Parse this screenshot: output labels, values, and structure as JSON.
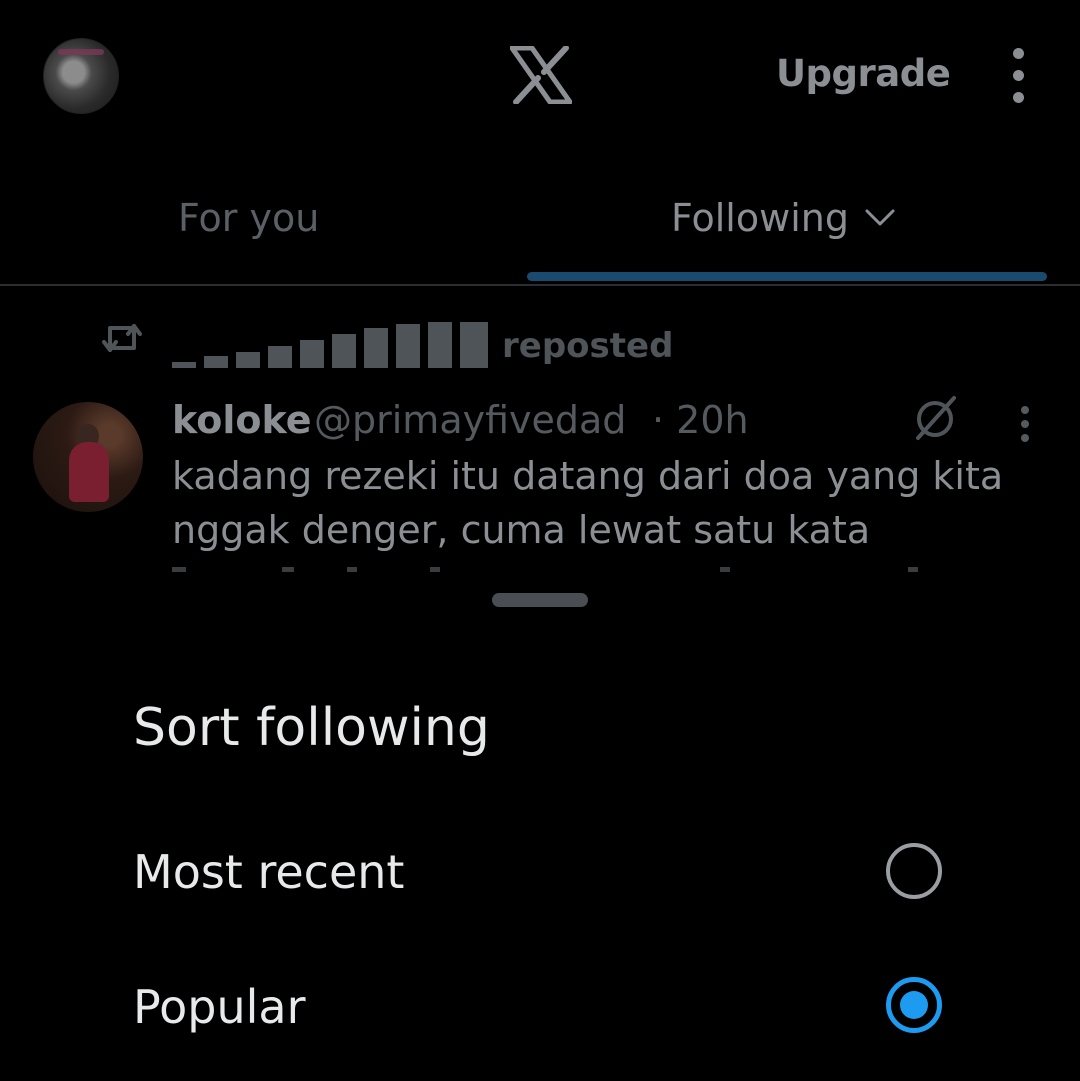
{
  "header": {
    "upgrade_label": "Upgrade",
    "logo_icon": "x-logo-icon",
    "more_icon": "more-vertical-icon"
  },
  "tabs": [
    {
      "label": "For you",
      "selected": false
    },
    {
      "label": "Following",
      "selected": true
    }
  ],
  "feed": {
    "repost": {
      "label": "reposted",
      "icon": "repost-icon"
    },
    "tweet": {
      "name": "koloke",
      "handle": "@primayfivedad",
      "time": "· 20h",
      "lines": [
        "kadang rezeki itu datang dari doa yang kita",
        "nggak denger, cuma lewat satu kata"
      ]
    }
  },
  "sheet": {
    "title": "Sort following",
    "options": [
      {
        "label": "Most recent",
        "selected": false
      },
      {
        "label": "Popular",
        "selected": true
      }
    ]
  },
  "colors": {
    "accent": "#1d9bf0",
    "background": "#000000",
    "text": "#e7e9ea"
  }
}
